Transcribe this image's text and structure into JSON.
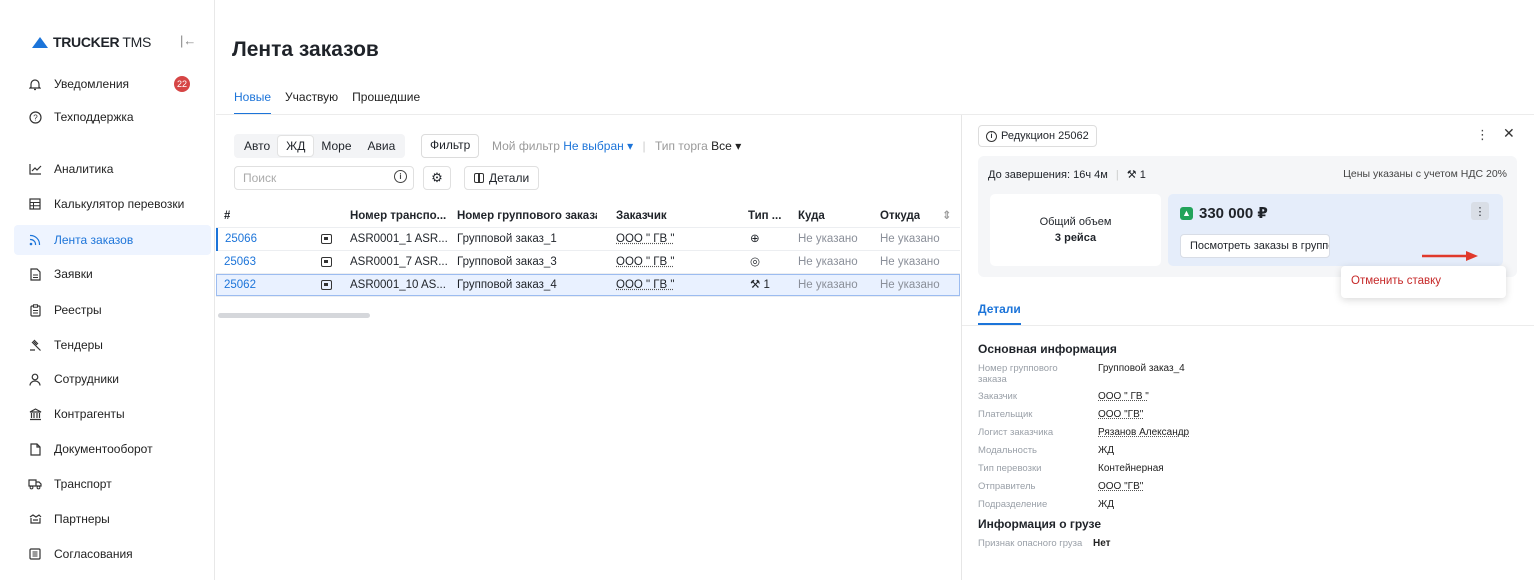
{
  "app": {
    "logo_brand": "TRUCKER",
    "logo_suffix": "TMS"
  },
  "sidebar": {
    "items": [
      {
        "label": "Уведомления",
        "icon": "bell-icon",
        "badge": "22"
      },
      {
        "label": "Техподдержка",
        "icon": "help-icon"
      },
      {
        "label": "Аналитика",
        "icon": "chart-icon"
      },
      {
        "label": "Калькулятор перевозки",
        "icon": "calculator-icon"
      },
      {
        "label": "Лента заказов",
        "icon": "feed-icon",
        "active": true
      },
      {
        "label": "Заявки",
        "icon": "document-icon"
      },
      {
        "label": "Реестры",
        "icon": "clipboard-icon"
      },
      {
        "label": "Тендеры",
        "icon": "gavel-icon"
      },
      {
        "label": "Сотрудники",
        "icon": "user-icon"
      },
      {
        "label": "Контрагенты",
        "icon": "bank-icon"
      },
      {
        "label": "Документооборот",
        "icon": "file-icon"
      },
      {
        "label": "Транспорт",
        "icon": "truck-icon"
      },
      {
        "label": "Партнеры",
        "icon": "handshake-icon"
      },
      {
        "label": "Согласования",
        "icon": "list-icon"
      }
    ]
  },
  "main": {
    "title": "Лента заказов",
    "tabs": [
      {
        "label": "Новые",
        "active": true
      },
      {
        "label": "Участвую"
      },
      {
        "label": "Прошедшие"
      }
    ],
    "modes": [
      {
        "label": "Авто"
      },
      {
        "label": "ЖД",
        "active": true
      },
      {
        "label": "Море"
      },
      {
        "label": "Авиа"
      }
    ],
    "filter_label": "Фильтр",
    "my_filter_label": "Мой фильтр",
    "my_filter_value": "Не выбран",
    "trade_type_label": "Тип торга",
    "trade_type_value": "Все",
    "search_placeholder": "Поиск",
    "details_button": "Детали"
  },
  "table": {
    "columns": [
      "#",
      "Номер транспо...",
      "Номер группового заказа",
      "Заказчик",
      "Тип ...",
      "Куда",
      "Откуда"
    ],
    "rows": [
      {
        "id": "25066",
        "transport": "ASR0001_1 ASR...",
        "group": "Групповой заказ_1",
        "customer": "ООО \" ГВ \"",
        "type": "⊕",
        "to": "Не указано",
        "from": "Не указано"
      },
      {
        "id": "25063",
        "transport": "ASR0001_7 ASR...",
        "group": "Групповой заказ_3",
        "customer": "ООО \" ГВ \"",
        "type": "◎",
        "to": "Не указано",
        "from": "Не указано"
      },
      {
        "id": "25062",
        "transport": "ASR0001_10 AS...",
        "group": "Групповой заказ_4",
        "customer": "ООО \" ГВ \"",
        "type": "⚒ 1",
        "to": "Не указано",
        "from": "Не указано",
        "selected": true
      }
    ]
  },
  "panel": {
    "chip": "Редукцион 25062",
    "remaining": "До завершения: 16ч 4м",
    "bids": "1",
    "vat_note": "Цены указаны с учетом НДС 20%",
    "volume_label": "Общий объем",
    "volume_value": "3 рейса",
    "price": "330 000 ₽",
    "view_orders": "Посмотреть заказы в групповом",
    "cancel_bid": "Отменить ставку",
    "details_tab": "Детали",
    "section_main": "Основная информация",
    "section_cargo": "Информация о грузе",
    "fields": [
      {
        "key": "Номер группового заказа",
        "value": "Групповой заказ_4"
      },
      {
        "key": "Заказчик",
        "value": "ООО \" ГВ \"",
        "link": true
      },
      {
        "key": "Плательщик",
        "value": "ООО \"ГВ\"",
        "link": true
      },
      {
        "key": "Логист заказчика",
        "value": "Рязанов Александр",
        "link": true
      },
      {
        "key": "Модальность",
        "value": "ЖД"
      },
      {
        "key": "Тип перевозки",
        "value": "Контейнерная"
      },
      {
        "key": "Отправитель",
        "value": "ООО \"ГВ\"",
        "link": true
      },
      {
        "key": "Подразделение",
        "value": "ЖД"
      }
    ],
    "cargo_key": "Признак опасного груза",
    "cargo_value": "Нет"
  },
  "colors": {
    "accent": "#1c74d9",
    "danger": "#c62828",
    "success": "#22a35a"
  }
}
